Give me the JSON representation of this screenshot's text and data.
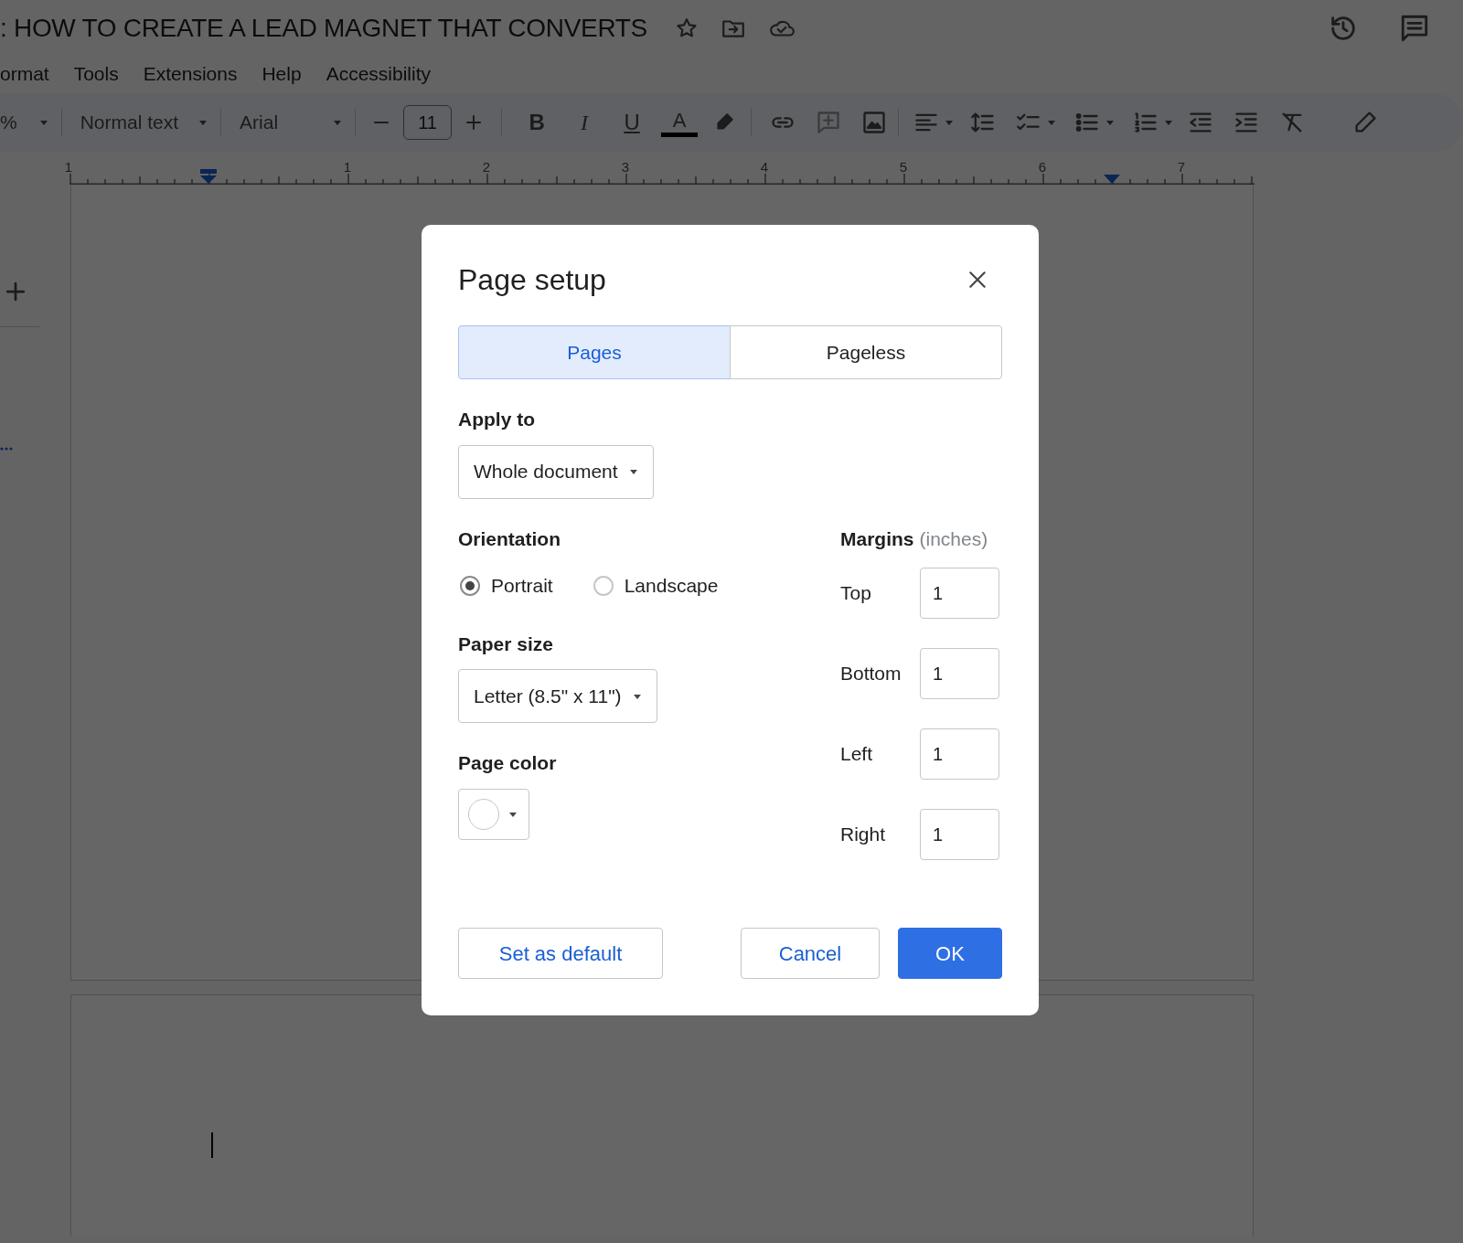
{
  "document": {
    "title": ": HOW TO CREATE A LEAD MAGNET THAT CONVERTS"
  },
  "menu": [
    {
      "label": "ormat"
    },
    {
      "label": "Tools"
    },
    {
      "label": "Extensions"
    },
    {
      "label": "Help"
    },
    {
      "label": "Accessibility"
    }
  ],
  "toolbar": {
    "zoom": "%",
    "style": "Normal text",
    "font": "Arial",
    "font_size": "11",
    "format_buttons": [
      {
        "kind": "bold",
        "label": "B"
      },
      {
        "kind": "italic",
        "label": "I"
      },
      {
        "kind": "underline",
        "label": "U"
      },
      {
        "kind": "text_color",
        "label": "A"
      }
    ]
  },
  "ruler": {
    "labels": [
      "1",
      "1",
      "2",
      "3",
      "4",
      "5",
      "6",
      "7"
    ]
  },
  "dialog": {
    "title": "Page setup",
    "tabs": [
      {
        "label": "Pages",
        "selected": true
      },
      {
        "label": "Pageless",
        "selected": false
      }
    ],
    "apply_to": {
      "label": "Apply to",
      "value": "Whole document"
    },
    "orientation": {
      "label": "Orientation",
      "options": [
        {
          "label": "Portrait",
          "selected": true
        },
        {
          "label": "Landscape",
          "selected": false
        }
      ]
    },
    "paper_size": {
      "label": "Paper size",
      "value": "Letter (8.5\" x 11\")"
    },
    "page_color": {
      "label": "Page color",
      "color": "#ffffff"
    },
    "margins": {
      "label": "Margins",
      "unit": "(inches)",
      "fields": [
        {
          "label": "Top",
          "value": "1"
        },
        {
          "label": "Bottom",
          "value": "1"
        },
        {
          "label": "Left",
          "value": "1"
        },
        {
          "label": "Right",
          "value": "1"
        }
      ]
    },
    "buttons": [
      {
        "label": "Set as default",
        "kind": "secondary"
      },
      {
        "label": "Cancel",
        "kind": "secondary"
      },
      {
        "label": "OK",
        "kind": "primary"
      }
    ]
  }
}
